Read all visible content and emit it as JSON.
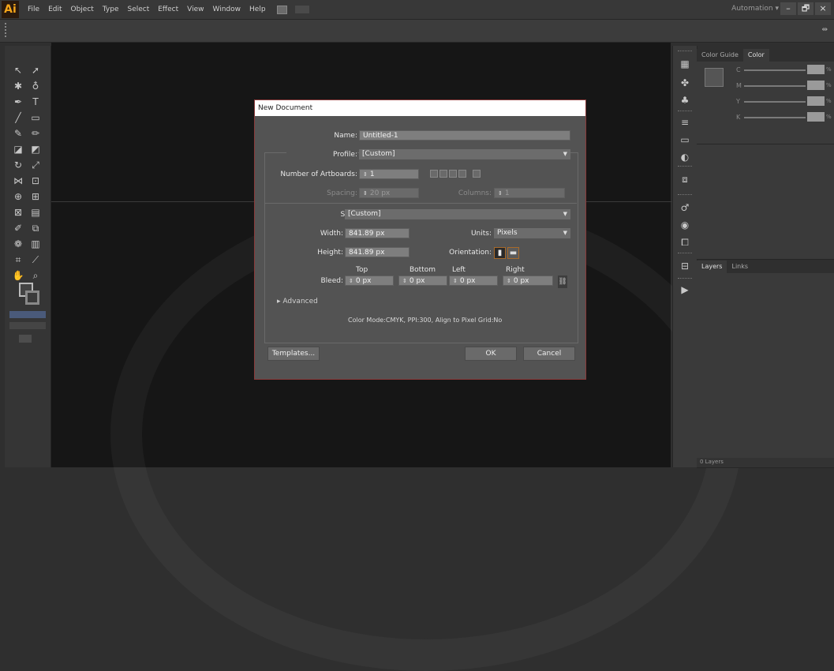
{
  "menubar": {
    "logo": "Ai",
    "items": [
      "File",
      "Edit",
      "Object",
      "Type",
      "Select",
      "Effect",
      "View",
      "Window",
      "Help"
    ],
    "workspace": "Automation",
    "workspace_caret": "▾"
  },
  "window_buttons": {
    "minimize": "–",
    "restore": "🗗",
    "close": "×"
  },
  "ctrlbar": {
    "right_icon": "⇹"
  },
  "color_panel": {
    "tabs": [
      "Color Guide",
      "Color"
    ],
    "channels": [
      "C",
      "M",
      "Y",
      "K"
    ],
    "pct": "%"
  },
  "layers_panel": {
    "tabs": [
      "Layers",
      "Links"
    ],
    "footer": "0 Layers"
  },
  "dialog": {
    "title": "New Document",
    "name_label": "Name:",
    "name_value": "Untitled-1",
    "profile_label": "Profile:",
    "profile_value": "[Custom]",
    "artboards_label": "Number of Artboards:",
    "artboards_value": "1",
    "spacing_label": "Spacing:",
    "spacing_value": "20 px",
    "columns_label": "Columns:",
    "columns_value": "1",
    "size_label": "Size:",
    "size_value": "[Custom]",
    "width_label": "Width:",
    "width_value": "841.89 px",
    "units_label": "Units:",
    "units_value": "Pixels",
    "height_label": "Height:",
    "height_value": "841.89 px",
    "orientation_label": "Orientation:",
    "bleed_label": "Bleed:",
    "bleed_headers": [
      "Top",
      "Bottom",
      "Left",
      "Right"
    ],
    "bleed_values": [
      "0 px",
      "0 px",
      "0 px",
      "0 px"
    ],
    "advanced_label": "Advanced",
    "info_text": "Color Mode:CMYK, PPI:300, Align to Pixel Grid:No",
    "templates_button": "Templates...",
    "ok_button": "OK",
    "cancel_button": "Cancel"
  },
  "colors": {
    "accent": "#f7a61a",
    "dialog_border": "#8a3a3a",
    "canvas": "#161616"
  }
}
